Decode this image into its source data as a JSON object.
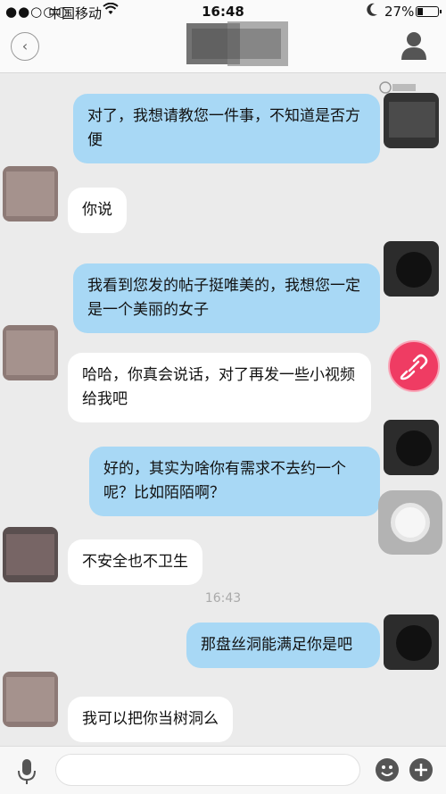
{
  "status_bar": {
    "signal": "●●○○○",
    "carrier": "中国移动",
    "time": "16:48",
    "battery_percent": "27%"
  },
  "header": {
    "back_icon": "chevron-left-icon",
    "profile_icon": "person-icon"
  },
  "messages": [
    {
      "direction": "out",
      "text": "对了，我想请教您一件事，不知道是否方便"
    },
    {
      "direction": "in",
      "text": "你说"
    },
    {
      "direction": "out",
      "text": "我看到您发的帖子挺唯美的，我想您一定是一个美丽的女子"
    },
    {
      "direction": "in",
      "text": "哈哈，你真会说话，对了再发一些小视频给我吧"
    },
    {
      "direction": "out",
      "text": "好的，其实为啥你有需求不去约一个呢？比如陌陌啊？"
    },
    {
      "direction": "in",
      "text": "不安全也不卫生"
    },
    {
      "direction": "out",
      "text": "那盘丝洞能满足你是吧"
    },
    {
      "direction": "in",
      "text": "我可以把你当树洞么"
    }
  ],
  "time_divider": "16:43",
  "input_bar": {
    "placeholder": "",
    "mic_icon": "microphone-icon",
    "emoji_icon": "smiley-icon",
    "plus_icon": "plus-icon"
  },
  "colors": {
    "outgoing_bubble": "#a8d8f5",
    "incoming_bubble": "#ffffff",
    "background": "#ebebeb",
    "share_button": "#ef3c63"
  }
}
